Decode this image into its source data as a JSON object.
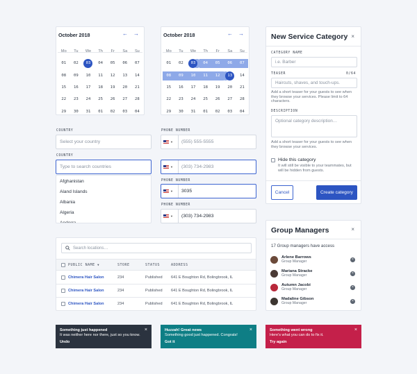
{
  "calendars": [
    {
      "month": "October 2018",
      "dow": [
        "Mo",
        "Tu",
        "We",
        "Th",
        "Fr",
        "Sa",
        "Su"
      ],
      "weeks": [
        [
          "01",
          "02",
          "03",
          "04",
          "05",
          "06",
          "07"
        ],
        [
          "08",
          "09",
          "10",
          "11",
          "12",
          "13",
          "14"
        ],
        [
          "15",
          "16",
          "17",
          "18",
          "19",
          "20",
          "21"
        ],
        [
          "22",
          "23",
          "24",
          "25",
          "26",
          "27",
          "28"
        ],
        [
          "29",
          "30",
          "31",
          "01",
          "02",
          "03",
          "04"
        ]
      ]
    },
    {
      "month": "October 2018",
      "dow": [
        "Mo",
        "Tu",
        "We",
        "Th",
        "Fr",
        "Sa",
        "Su"
      ],
      "weeks": [
        [
          "01",
          "02",
          "03",
          "04",
          "05",
          "06",
          "07"
        ],
        [
          "08",
          "09",
          "10",
          "11",
          "12",
          "13",
          "14"
        ],
        [
          "15",
          "16",
          "17",
          "18",
          "19",
          "20",
          "21"
        ],
        [
          "22",
          "23",
          "24",
          "25",
          "26",
          "27",
          "28"
        ],
        [
          "29",
          "30",
          "31",
          "01",
          "02",
          "03",
          "04"
        ]
      ]
    }
  ],
  "nav": {
    "prev": "←",
    "next": "→"
  },
  "country": {
    "label": "COUNTRY",
    "placeholder": "Select your country",
    "search_placeholder": "Type to search countries",
    "options": [
      "Afghanistan",
      "Aland Islands",
      "Albania",
      "Algeria",
      "Andorra"
    ]
  },
  "phone": {
    "label": "PHONE NUMBER",
    "fields": [
      {
        "value": "(555) 555-5555",
        "placeholder": true
      },
      {
        "value": "(303) 734-2983",
        "placeholder": true
      },
      {
        "value": "3035",
        "placeholder": false
      },
      {
        "value": "(303) 734-2983",
        "placeholder": false
      }
    ]
  },
  "table": {
    "search_placeholder": "Search locations…",
    "headers": [
      "PUBLIC NAME",
      "STORE",
      "STATUS",
      "ADDRESS"
    ],
    "rows": [
      [
        "Chimera Hair Salon",
        "234",
        "Published",
        "641 E Boughton Rd, Bolingbrook, IL"
      ],
      [
        "Chimera Hair Salon",
        "234",
        "Published",
        "641 E Boughton Rd, Bolingbrook, IL"
      ],
      [
        "Chimera Hair Salon",
        "234",
        "Published",
        "641 E Boughton Rd, Bolingbrook, IL"
      ]
    ]
  },
  "toasts": [
    {
      "title": "Something just happened",
      "body": "It was neither here nor there, just so you know.",
      "action": "Undo",
      "color": "#2b333f"
    },
    {
      "title": "Huzzah! Great news",
      "body": "Something good just happened. Congrats!",
      "action": "Got it",
      "color": "#0e7e85"
    },
    {
      "title": "Something went wrong",
      "body": "Here's what you can do to fix it.",
      "action": "Try again",
      "color": "#c4204a"
    }
  ],
  "service": {
    "title": "New Service Category",
    "name_label": "CATEGORY NAME",
    "name_placeholder": "i.e. Barber",
    "teaser_label": "TEASER",
    "teaser_count": "0/64",
    "teaser_placeholder": "Haircuts, shaves, and touch-ups.",
    "teaser_help": "Add a short teaser for your guests to see when they browse your services. Please limit to 64 characters.",
    "desc_label": "DESCRIPTION",
    "desc_placeholder": "Optional category description…",
    "desc_help": "Add a short teaser for your guests to see when they browse your services.",
    "hide_label": "Hide this category",
    "hide_help": "It will still be visible to your teammates, but will be hidden from guests.",
    "cancel": "Cancel",
    "create": "Create category"
  },
  "managers": {
    "title": "Group Managers",
    "count_text": "17 Group managers have access",
    "items": [
      {
        "name": "Arlene Barrows",
        "role": "Group Manager",
        "color": "#6b4a3a"
      },
      {
        "name": "Mariana Stracke",
        "role": "Group Manager",
        "color": "#4a3a35"
      },
      {
        "name": "Autumn Jacobi",
        "role": "Group Manager",
        "color": "#b8283a"
      },
      {
        "name": "Madaline Gibson",
        "role": "Group Manager",
        "color": "#3c3530"
      }
    ]
  },
  "icons": {
    "close": "×",
    "search": "search-icon",
    "sort": "▼",
    "remove": "×"
  }
}
